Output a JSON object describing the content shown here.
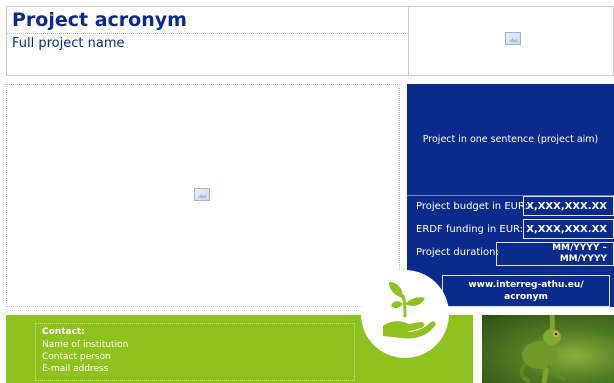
{
  "header": {
    "acronym": "Project acronym",
    "full_name": "Full project name"
  },
  "panel": {
    "aim": "Project in one sentence (project aim)",
    "budget_label": "Project budget in EUR:",
    "budget_value": "X,XXX,XXX.XX",
    "erdf_label": "ERDF funding in EUR:",
    "erdf_value": "X,XXX,XXX.XX",
    "duration_label": "Project duration:",
    "duration_value_1": "MM/YYYY –",
    "duration_value_2": "MM/YYYY",
    "website_1": "www.interreg-athu.eu/",
    "website_2": "acronym"
  },
  "contact": {
    "title": "Contact:",
    "institution": "Name of institution",
    "person": "Contact person",
    "email": "E-mail address"
  },
  "colors": {
    "blue": "#0a2a8c",
    "green": "#8fc21e"
  },
  "icons": {
    "emblem": "hand-holding-plant-icon",
    "placeholder": "image-placeholder-icon"
  }
}
